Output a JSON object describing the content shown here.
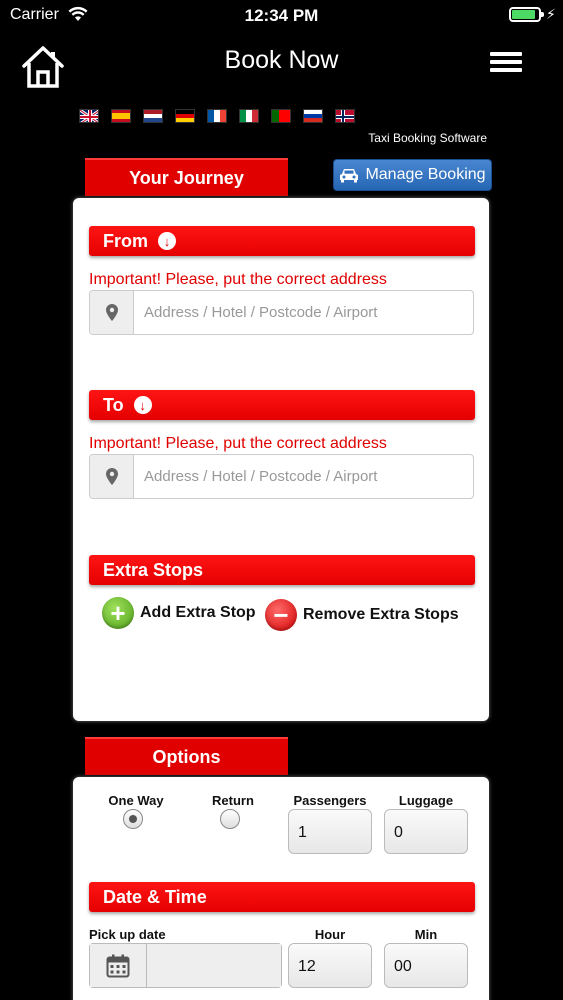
{
  "status": {
    "carrier": "Carrier",
    "time": "12:34 PM"
  },
  "nav": {
    "title": "Book Now",
    "home_icon": "home-icon",
    "menu_icon": "hamburger-menu-icon"
  },
  "languages": [
    "english-flag",
    "spanish-flag",
    "dutch-flag",
    "german-flag",
    "french-flag",
    "italian-flag",
    "portuguese-flag",
    "russian-flag",
    "norwegian-flag"
  ],
  "brand_tagline": "Taxi Booking Software",
  "journey": {
    "tab_label": "Your Journey",
    "manage_booking": "Manage Booking",
    "from": {
      "label": "From",
      "warning": "Important! Please, put the correct address",
      "placeholder": "Address / Hotel / Postcode / Airport",
      "value": ""
    },
    "to": {
      "label": "To",
      "warning": "Important! Please, put the correct address",
      "placeholder": "Address / Hotel / Postcode / Airport",
      "value": ""
    },
    "extra_stops": {
      "label": "Extra Stops",
      "add": "Add Extra Stop",
      "remove": "Remove Extra Stops"
    }
  },
  "options": {
    "tab_label": "Options",
    "one_way": "One Way",
    "return": "Return",
    "selected_trip": "one_way",
    "passengers_label": "Passengers",
    "passengers": "1",
    "luggage_label": "Luggage",
    "luggage": "0"
  },
  "datetime": {
    "label": "Date & Time",
    "pickup_label": "Pick up date",
    "pickup_value": "",
    "hour_label": "Hour",
    "hour": "12",
    "min_label": "Min",
    "min": "00"
  },
  "colors": {
    "accent_red": "#e00000",
    "manage_blue": "#2f6fbf",
    "background": "#000000"
  }
}
